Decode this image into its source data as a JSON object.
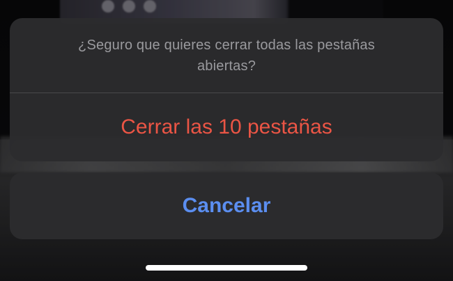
{
  "action_sheet": {
    "message": "¿Seguro que quieres cerrar todas las pestañas abiertas?",
    "destructive_action_label": "Cerrar las 10 pestañas",
    "cancel_label": "Cancelar"
  },
  "colors": {
    "destructive": "#eb5545",
    "accent": "#5b8ef0",
    "message_text": "#9a9a9e",
    "sheet_background": "#2c2c2e"
  },
  "icons": [
    "home-indicator"
  ]
}
